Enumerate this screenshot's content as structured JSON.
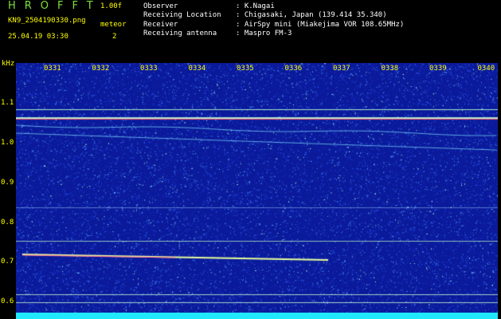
{
  "header": {
    "logo": "HROFFT",
    "version": "1.00f",
    "filename": "KN9_2504190330.png",
    "meteor_label": "meteor",
    "datetime": "25.04.19 03:30",
    "meteor_count": "2"
  },
  "info": [
    {
      "key": "Observer",
      "value": ": K.Nagai"
    },
    {
      "key": "Receiving Location",
      "value": ": Chigasaki, Japan (139.414 35.340)"
    },
    {
      "key": "Receiver",
      "value": ": AirSpy mini (Miakejima VOR 108.65MHz)"
    },
    {
      "key": "Receiving antenna",
      "value": ": Maspro FM-3"
    }
  ],
  "spectrogram": {
    "y_unit": "kHz",
    "y_ticks": [
      "1.1",
      "1.0",
      "0.9",
      "0.8",
      "0.7",
      "0.6"
    ],
    "x_ticks": [
      "0331",
      "0332",
      "0333",
      "0334",
      "0335",
      "0336",
      "0337",
      "0338",
      "0339",
      "0340"
    ],
    "background_color": "#0a1a9a",
    "noise_color": "#2b5bff",
    "line_color": "#c8ffd0",
    "strong_line_color": "#ff4a6a",
    "bottom_band_color": "#20e8ff"
  }
}
